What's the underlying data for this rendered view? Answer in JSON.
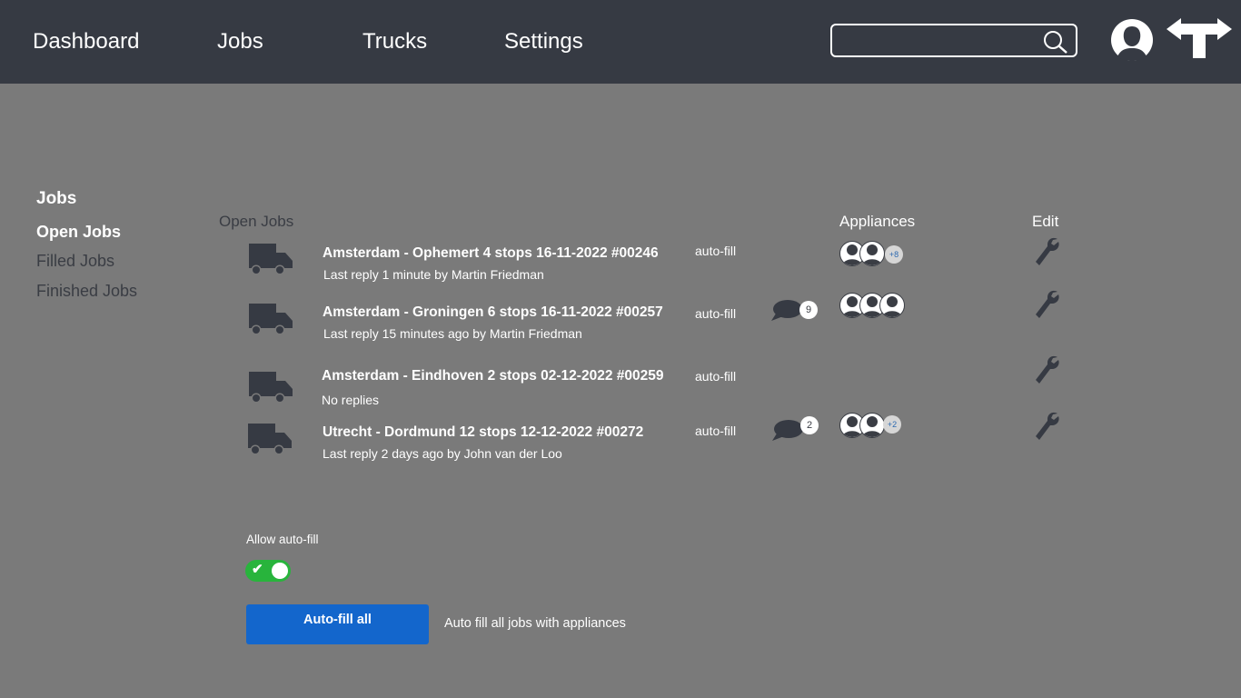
{
  "nav": {
    "items": [
      "Dashboard",
      "Jobs",
      "Trucks",
      "Settings"
    ],
    "search_value": ""
  },
  "sidebar": {
    "title": "Jobs",
    "items": [
      {
        "label": "Open Jobs",
        "active": true
      },
      {
        "label": "Filled Jobs",
        "active": false
      },
      {
        "label": "Finished Jobs",
        "active": false
      }
    ]
  },
  "table": {
    "headers": {
      "open_jobs": "Open Jobs",
      "appliances": "Appliances",
      "edit": "Edit"
    },
    "jobs": [
      {
        "title": "Amsterdam - Ophemert 4 stops 16-11-2022 #00246",
        "subtitle": "Last reply 1 minute by Martin Friedman",
        "autofill": "auto-fill",
        "comments": "",
        "appliance_avatars": 2,
        "appliances_more": "+8"
      },
      {
        "title": "Amsterdam - Groningen 6 stops 16-11-2022 #00257",
        "subtitle": "Last reply 15 minutes ago by Martin Friedman",
        "autofill": "auto-fill",
        "comments": "9",
        "appliance_avatars": 3,
        "appliances_more": ""
      },
      {
        "title": "Amsterdam - Eindhoven 2 stops 02-12-2022 #00259",
        "subtitle": "No replies",
        "autofill": "auto-fill",
        "comments": "",
        "appliance_avatars": 0,
        "appliances_more": ""
      },
      {
        "title": "Utrecht - Dordmund 12 stops 12-12-2022 #00272",
        "subtitle": "Last reply 2 days ago by John van der Loo",
        "autofill": "auto-fill",
        "comments": "2",
        "appliance_avatars": 2,
        "appliances_more": "+2"
      }
    ]
  },
  "autofill": {
    "allow_label": "Allow auto-fill",
    "enabled": true,
    "button_label": "Auto-fill all",
    "hint": "Auto fill all jobs with appliances"
  },
  "colors": {
    "topbar": "#363a43",
    "background": "#7a7a7a",
    "primary": "#1366cc",
    "toggle_on": "#28b43c",
    "icon_dark": "#3a3d44"
  },
  "icons": {
    "search": "search-icon",
    "profile": "user-avatar-icon",
    "logout": "signpost-arrows-icon",
    "truck": "truck-icon",
    "comment": "speech-bubble-icon",
    "edit": "wrench-icon"
  }
}
